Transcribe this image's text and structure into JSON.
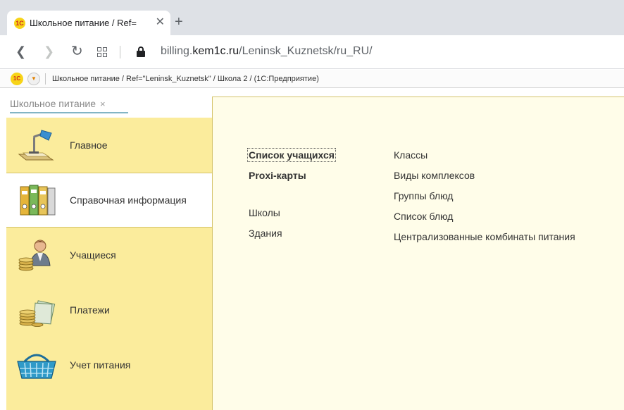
{
  "browser": {
    "tab": {
      "favicon": "1С",
      "title": "Школьное питание / Ref=",
      "close_icon": "close-icon"
    },
    "new_tab_icon": "plus-icon",
    "url": {
      "prefix": "billing.",
      "host": "kem1c.ru",
      "path": "/Leninsk_Kuznetsk/ru_RU/"
    }
  },
  "titlebar": {
    "logo": "1С",
    "title": "Школьное питание / Ref=\"Leninsk_Kuznetsk\" / Школа 2 /   (1С:Предприятие)"
  },
  "section_tab": {
    "label": "Школьное питание",
    "close": "×"
  },
  "sidebar": {
    "items": [
      {
        "label": "Главное",
        "icon": "desk-lamp-icon",
        "active": false
      },
      {
        "label": "Справочная информация",
        "icon": "binders-icon",
        "active": true
      },
      {
        "label": "Учащиеся",
        "icon": "student-coins-icon",
        "active": false
      },
      {
        "label": "Платежи",
        "icon": "coins-banknotes-icon",
        "active": false
      },
      {
        "label": "Учет питания",
        "icon": "basket-icon",
        "active": false
      }
    ]
  },
  "content": {
    "left_column": [
      {
        "label": "Список учащихся",
        "bold": true,
        "focused": true
      },
      {
        "label": "Proxi-карты",
        "bold": true,
        "focused": false
      },
      {
        "label": "Школы",
        "bold": false,
        "focused": false
      },
      {
        "label": "Здания",
        "bold": false,
        "focused": false
      }
    ],
    "right_column": [
      {
        "label": "Классы"
      },
      {
        "label": "Виды комплексов"
      },
      {
        "label": "Группы блюд"
      },
      {
        "label": "Список блюд"
      },
      {
        "label": "Централизованные комбинаты питания"
      }
    ]
  },
  "colors": {
    "sidebar_bg": "#fbec9c",
    "content_bg": "#fffde9",
    "section_underline": "#82b5c4"
  }
}
